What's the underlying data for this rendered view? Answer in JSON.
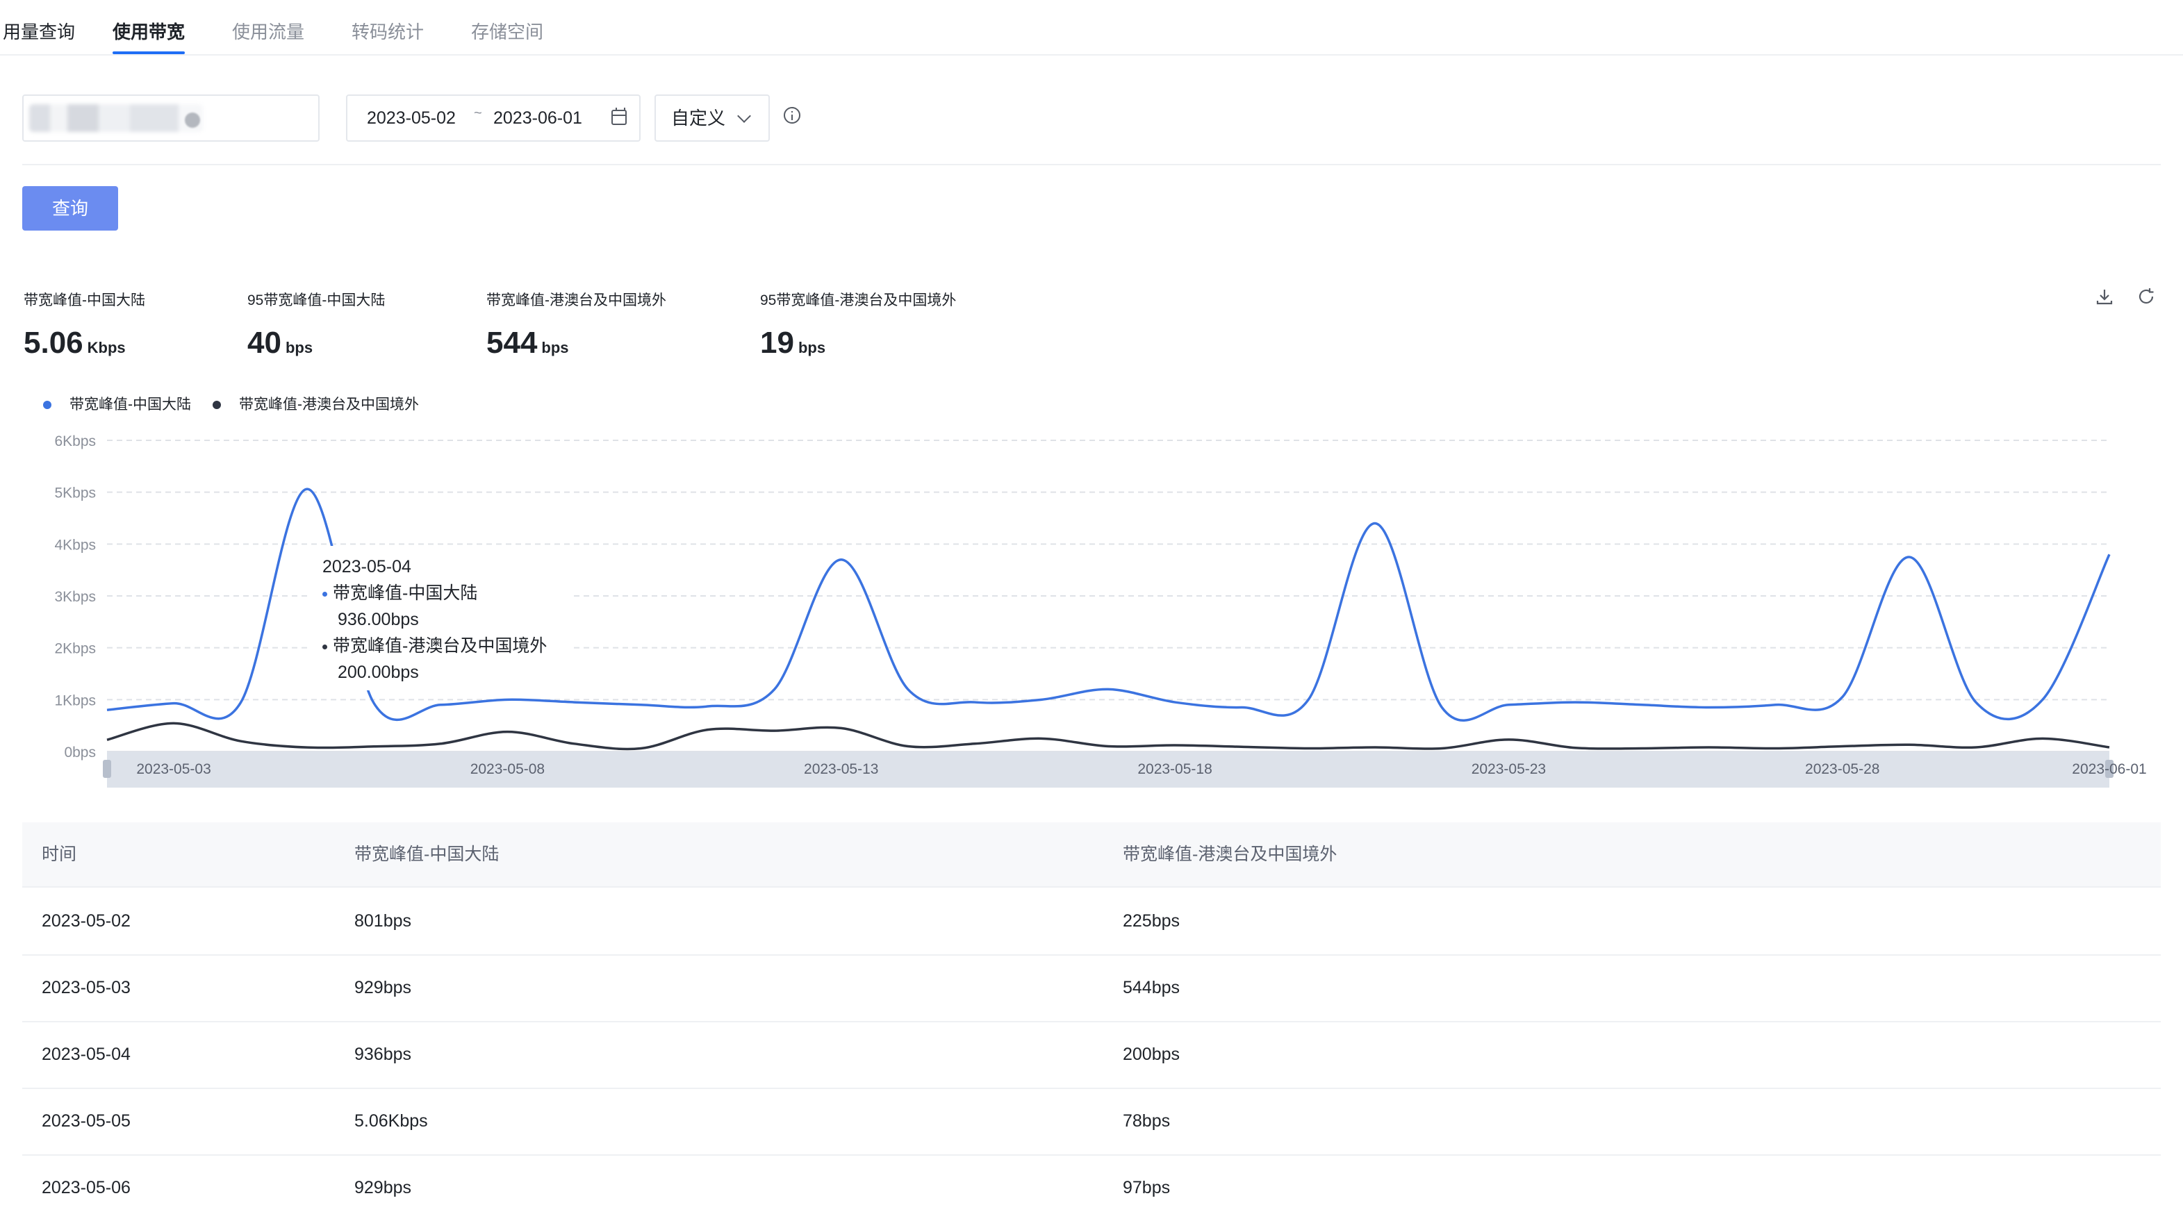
{
  "tabs": [
    "用量查询",
    "使用带宽",
    "使用流量",
    "转码统计",
    "存储空间"
  ],
  "filters": {
    "date_start": "2023-05-02",
    "date_sep": "~",
    "date_end": "2023-06-01",
    "range_select": "自定义",
    "query_button": "查询"
  },
  "stats": [
    {
      "label": "带宽峰值-中国大陆",
      "value": "5.06",
      "unit": "Kbps"
    },
    {
      "label": "95带宽峰值-中国大陆",
      "value": "40",
      "unit": "bps"
    },
    {
      "label": "带宽峰值-港澳台及中国境外",
      "value": "544",
      "unit": "bps"
    },
    {
      "label": "95带宽峰值-港澳台及中国境外",
      "value": "19",
      "unit": "bps"
    }
  ],
  "icons": {
    "download": "download-icon",
    "refresh": "refresh-icon",
    "calendar": "calendar-icon",
    "info": "info-icon",
    "chevron": "chevron-down-icon"
  },
  "colors": {
    "series_mainland": "#3b73e0",
    "series_overseas": "#2f3542",
    "accent": "#1f6ef5",
    "button": "#6b8cf0"
  },
  "chart_data": {
    "type": "line",
    "x": [
      "2023-05-02",
      "2023-05-03",
      "2023-05-04",
      "2023-05-05",
      "2023-05-06",
      "2023-05-07",
      "2023-05-08",
      "2023-05-09",
      "2023-05-10",
      "2023-05-11",
      "2023-05-12",
      "2023-05-13",
      "2023-05-14",
      "2023-05-15",
      "2023-05-16",
      "2023-05-17",
      "2023-05-18",
      "2023-05-19",
      "2023-05-20",
      "2023-05-21",
      "2023-05-22",
      "2023-05-23",
      "2023-05-24",
      "2023-05-25",
      "2023-05-26",
      "2023-05-27",
      "2023-05-28",
      "2023-05-29",
      "2023-05-30",
      "2023-05-31",
      "2023-06-01"
    ],
    "x_tick_labels": [
      "2023-05-03",
      "2023-05-08",
      "2023-05-13",
      "2023-05-18",
      "2023-05-23",
      "2023-05-28",
      "2023-06-01"
    ],
    "y_tick_labels": [
      "0bps",
      "1Kbps",
      "2Kbps",
      "3Kbps",
      "4Kbps",
      "5Kbps",
      "6Kbps"
    ],
    "ylim": [
      0,
      6000
    ],
    "grid": true,
    "legend_position": "top-left",
    "series": [
      {
        "name": "带宽峰值-中国大陆",
        "values": [
          801,
          929,
          936,
          5060,
          929,
          900,
          1000,
          950,
          900,
          870,
          1200,
          3700,
          1200,
          950,
          1000,
          1200,
          950,
          850,
          1000,
          4400,
          850,
          900,
          950,
          900,
          850,
          900,
          1050,
          3750,
          950,
          1000,
          3800
        ]
      },
      {
        "name": "带宽峰值-港澳台及中国境外",
        "values": [
          225,
          544,
          200,
          78,
          97,
          150,
          380,
          150,
          60,
          420,
          400,
          450,
          100,
          150,
          250,
          100,
          120,
          90,
          60,
          80,
          60,
          230,
          70,
          60,
          80,
          60,
          100,
          130,
          80,
          250,
          80
        ]
      }
    ]
  },
  "tooltip": {
    "date": "2023-05-04",
    "rows": [
      {
        "name": "带宽峰值-中国大陆",
        "value": "936.00bps"
      },
      {
        "name": "带宽峰值-港澳台及中国境外",
        "value": "200.00bps"
      }
    ]
  },
  "table": {
    "headers": [
      "时间",
      "带宽峰值-中国大陆",
      "带宽峰值-港澳台及中国境外"
    ],
    "rows": [
      [
        "2023-05-02",
        "801bps",
        "225bps"
      ],
      [
        "2023-05-03",
        "929bps",
        "544bps"
      ],
      [
        "2023-05-04",
        "936bps",
        "200bps"
      ],
      [
        "2023-05-05",
        "5.06Kbps",
        "78bps"
      ],
      [
        "2023-05-06",
        "929bps",
        "97bps"
      ]
    ]
  }
}
